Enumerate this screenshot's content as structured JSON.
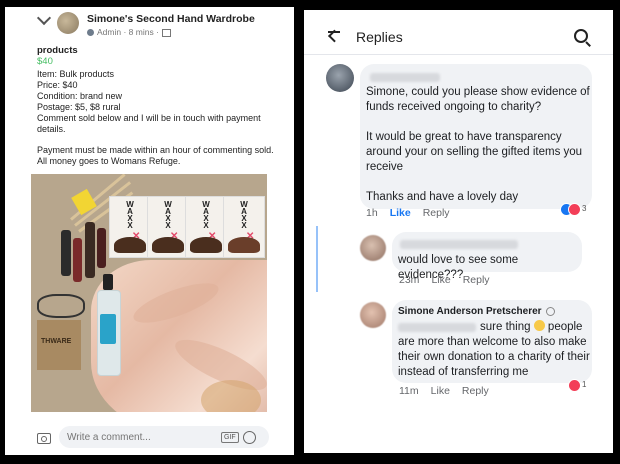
{
  "post": {
    "group_name": "Simone's Second Hand Wardrobe",
    "role": "Admin",
    "time": "8 mins",
    "title": "products",
    "price": "$40",
    "details": [
      "Item: Bulk products",
      "Price: $40",
      "Condition: brand new",
      "Postage: $5, $8 rural",
      "Comment sold below and I will be in touch with payment",
      "details."
    ],
    "footer": [
      "Payment must be made within an hour of commenting sold.",
      "All money goes to Womans Refuge."
    ],
    "photo_box_text": "WAXX",
    "photo_craft_text": "THWARE",
    "comment_placeholder": "Write a comment...",
    "gif_label": "GIF"
  },
  "replies": {
    "title": "Replies",
    "comment1": {
      "lines": [
        "Simone, could you please show evidence of",
        "funds received ongoing to charity?",
        "",
        "It would be great to have transparency",
        "around your on selling the gifted items you",
        "receive",
        "",
        "Thanks and have a lovely day"
      ],
      "time": "1h",
      "like": "Like",
      "reply": "Reply",
      "reactions": "3"
    },
    "comment2": {
      "text": "would love to see some evidence???",
      "time": "23m",
      "like": "Like",
      "reply": "Reply"
    },
    "comment3": {
      "author": "Simone Anderson Pretscherer",
      "line1": "sure thing",
      "line1_after": "people",
      "lines": [
        "are more than welcome to also make",
        "their own donation to a charity of their",
        "instead of transferring me"
      ],
      "time": "11m",
      "like": "Like",
      "reply": "Reply",
      "reactions": "1"
    }
  }
}
